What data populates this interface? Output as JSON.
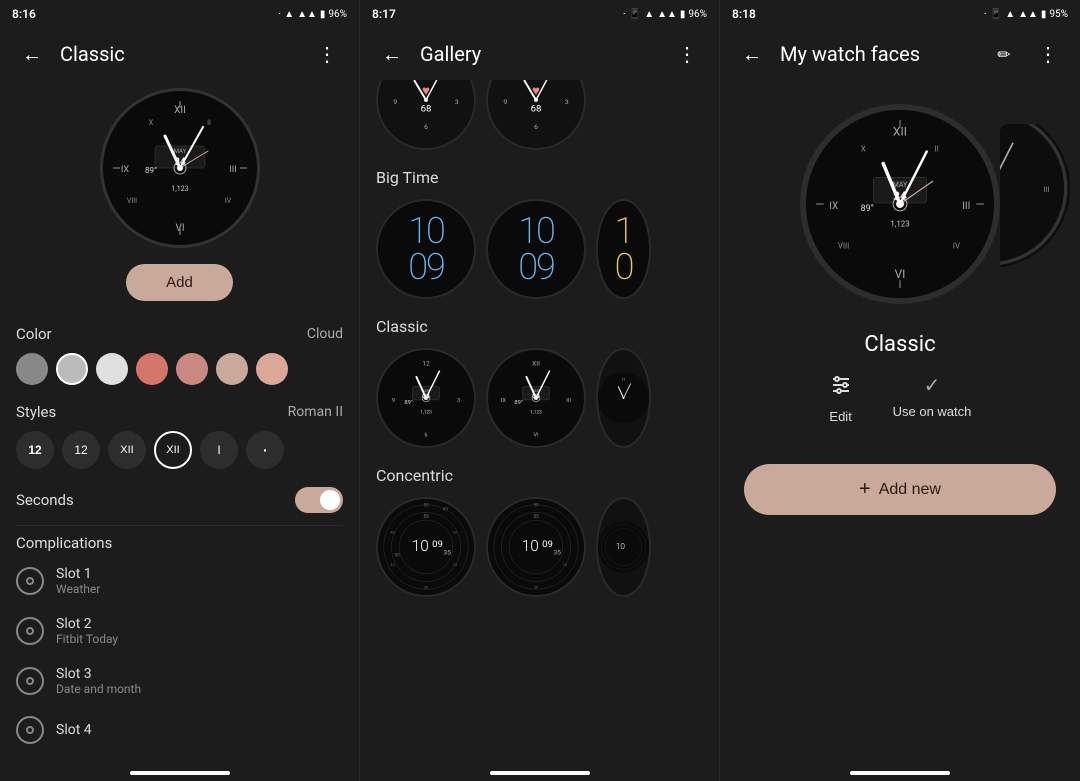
{
  "panels": {
    "left": {
      "status": {
        "time": "8:16",
        "battery": "96%",
        "icons": "bluetooth wifi signal battery"
      },
      "nav": {
        "title": "Classic",
        "back_label": "←",
        "more_label": "⋮"
      },
      "add_button": "Add",
      "color_section": {
        "label": "Color",
        "value": "Cloud"
      },
      "colors": [
        {
          "id": "gray",
          "hex": "#888",
          "selected": false
        },
        {
          "id": "light-gray",
          "hex": "#bbb",
          "selected": true
        },
        {
          "id": "white",
          "hex": "#e0e0e0",
          "selected": false
        },
        {
          "id": "coral",
          "hex": "#d4756a",
          "selected": false
        },
        {
          "id": "salmon",
          "hex": "#c98880",
          "selected": false
        },
        {
          "id": "dusty-rose",
          "hex": "#c9a99a",
          "selected": false
        },
        {
          "id": "peach",
          "hex": "#dba898",
          "selected": false
        }
      ],
      "styles_section": {
        "label": "Styles",
        "value": "Roman II"
      },
      "styles": [
        {
          "id": "12-bold",
          "label": "12",
          "selected": false
        },
        {
          "id": "12-thin",
          "label": "12",
          "selected": false
        },
        {
          "id": "xii-thin",
          "label": "XII",
          "selected": false
        },
        {
          "id": "xii-circle",
          "label": "XII",
          "selected": true
        },
        {
          "id": "i",
          "label": "I",
          "selected": false
        },
        {
          "id": "dot",
          "label": "·",
          "selected": false
        }
      ],
      "seconds_section": {
        "label": "Seconds",
        "toggle_on": true
      },
      "complications": {
        "title": "Complications",
        "items": [
          {
            "name": "Slot 1",
            "value": "Weather"
          },
          {
            "name": "Slot 2",
            "value": "Fitbit Today"
          },
          {
            "name": "Slot 3",
            "value": "Date and month"
          },
          {
            "name": "Slot 4",
            "value": ""
          }
        ]
      }
    },
    "center": {
      "status": {
        "time": "8:17",
        "battery": "96%"
      },
      "nav": {
        "title": "Gallery",
        "back_label": "←",
        "more_label": "⋮"
      },
      "sections": [
        {
          "title": "Big Time",
          "watches": [
            {
              "id": "bigtime-1",
              "style": "bigtime-blue"
            },
            {
              "id": "bigtime-2",
              "style": "bigtime-blue"
            },
            {
              "id": "bigtime-3",
              "style": "bigtime-yellow",
              "partial": true
            }
          ]
        },
        {
          "title": "Classic",
          "watches": [
            {
              "id": "classic-1",
              "style": "classic"
            },
            {
              "id": "classic-2",
              "style": "classic-dark"
            },
            {
              "id": "classic-3",
              "style": "classic",
              "partial": true
            }
          ]
        },
        {
          "title": "Concentric",
          "watches": [
            {
              "id": "conc-1",
              "style": "concentric"
            },
            {
              "id": "conc-2",
              "style": "concentric"
            },
            {
              "id": "conc-3",
              "style": "concentric",
              "partial": true
            }
          ]
        }
      ]
    },
    "right": {
      "status": {
        "time": "8:18",
        "battery": "95%"
      },
      "nav": {
        "title": "My watch faces",
        "back_label": "←",
        "pencil_label": "✏",
        "more_label": "⋮"
      },
      "watch_name": "Classic",
      "actions": [
        {
          "id": "edit",
          "icon": "sliders",
          "label": "Edit"
        },
        {
          "id": "use",
          "icon": "check",
          "label": "Use on watch"
        }
      ],
      "add_new_button": "+ Add new"
    }
  }
}
